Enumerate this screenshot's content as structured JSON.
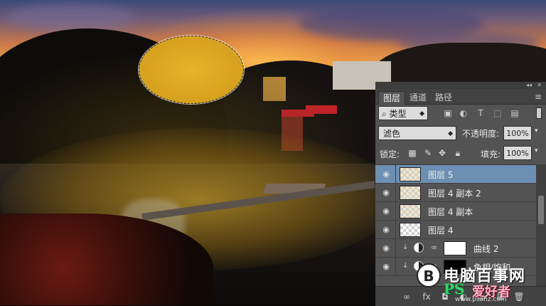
{
  "panel": {
    "tabs": [
      "图层",
      "通道",
      "路径"
    ],
    "active_tab": 0,
    "filter": {
      "label": "类型"
    },
    "blend_mode": "滤色",
    "opacity_label": "不透明度:",
    "opacity_value": "100%",
    "lock_label": "锁定:",
    "fill_label": "填充:",
    "fill_value": "100%",
    "layers": [
      {
        "name": "图层 5",
        "type": "pixel",
        "selected": true
      },
      {
        "name": "图层 4 副本 2",
        "type": "pixel",
        "selected": false
      },
      {
        "name": "图层 4 副本",
        "type": "pixel",
        "selected": false
      },
      {
        "name": "图层 4",
        "type": "pixel",
        "selected": false
      },
      {
        "name": "曲线 2",
        "type": "adjustment",
        "selected": false
      },
      {
        "name": "色相/饱和",
        "type": "adjustment",
        "selected": false
      }
    ]
  },
  "watermark": {
    "logo_glyph": "B",
    "title": "电脑百事网",
    "ps": "PS",
    "lovers": "爱好者",
    "url": "www.psahz.com"
  },
  "colors": {
    "panel_bg": "#535353",
    "selected_layer": "#6d8fb3",
    "selection_fill": "#d9a21e"
  }
}
